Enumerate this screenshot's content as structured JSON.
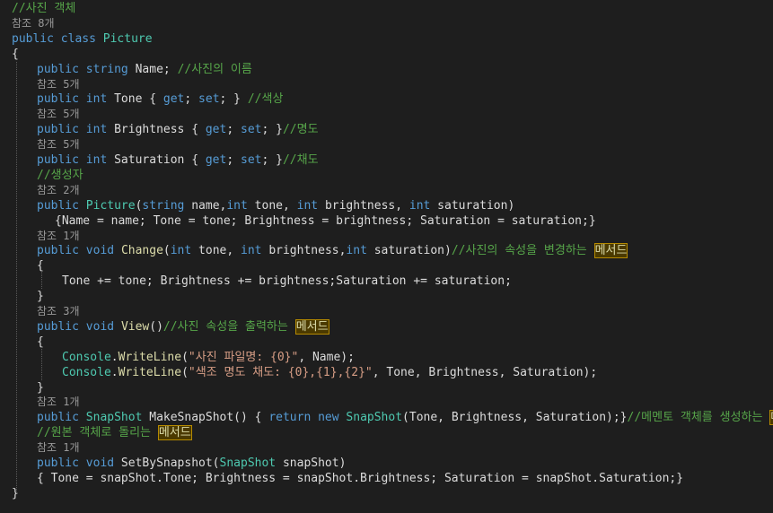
{
  "lines": [
    {
      "indent": 0,
      "kind": "comment",
      "segments": [
        {
          "t": "//사진 객체",
          "c": "cm"
        }
      ]
    },
    {
      "indent": 0,
      "kind": "lens",
      "segments": [
        {
          "t": "참조 8개",
          "c": "lens"
        }
      ]
    },
    {
      "indent": 0,
      "kind": "code",
      "segments": [
        {
          "t": "public",
          "c": "kw"
        },
        {
          "t": " "
        },
        {
          "t": "class",
          "c": "kw"
        },
        {
          "t": " "
        },
        {
          "t": "Picture",
          "c": "cl"
        }
      ]
    },
    {
      "indent": 0,
      "kind": "code",
      "segments": [
        {
          "t": "{"
        }
      ]
    },
    {
      "indent": 1,
      "kind": "code",
      "segments": [
        {
          "t": "public",
          "c": "kw"
        },
        {
          "t": " "
        },
        {
          "t": "string",
          "c": "kw"
        },
        {
          "t": " Name; "
        },
        {
          "t": "//사진의 이름",
          "c": "cm"
        }
      ]
    },
    {
      "indent": 1,
      "kind": "lens",
      "segments": [
        {
          "t": "참조 5개",
          "c": "lens"
        }
      ]
    },
    {
      "indent": 1,
      "kind": "code",
      "segments": [
        {
          "t": "public",
          "c": "kw"
        },
        {
          "t": " "
        },
        {
          "t": "int",
          "c": "kw"
        },
        {
          "t": " Tone { "
        },
        {
          "t": "get",
          "c": "kw"
        },
        {
          "t": "; "
        },
        {
          "t": "set",
          "c": "kw"
        },
        {
          "t": "; } "
        },
        {
          "t": "//색상",
          "c": "cm"
        }
      ]
    },
    {
      "indent": 1,
      "kind": "lens",
      "segments": [
        {
          "t": "참조 5개",
          "c": "lens"
        }
      ]
    },
    {
      "indent": 1,
      "kind": "code",
      "segments": [
        {
          "t": "public",
          "c": "kw"
        },
        {
          "t": " "
        },
        {
          "t": "int",
          "c": "kw"
        },
        {
          "t": " Brightness { "
        },
        {
          "t": "get",
          "c": "kw"
        },
        {
          "t": "; "
        },
        {
          "t": "set",
          "c": "kw"
        },
        {
          "t": "; }"
        },
        {
          "t": "//명도",
          "c": "cm"
        }
      ]
    },
    {
      "indent": 1,
      "kind": "lens",
      "segments": [
        {
          "t": "참조 5개",
          "c": "lens"
        }
      ]
    },
    {
      "indent": 1,
      "kind": "code",
      "segments": [
        {
          "t": "public",
          "c": "kw"
        },
        {
          "t": " "
        },
        {
          "t": "int",
          "c": "kw"
        },
        {
          "t": " Saturation { "
        },
        {
          "t": "get",
          "c": "kw"
        },
        {
          "t": "; "
        },
        {
          "t": "set",
          "c": "kw"
        },
        {
          "t": "; }"
        },
        {
          "t": "//채도",
          "c": "cm"
        }
      ]
    },
    {
      "indent": 1,
      "kind": "comment",
      "segments": [
        {
          "t": "//생성자",
          "c": "cm"
        }
      ]
    },
    {
      "indent": 1,
      "kind": "lens",
      "segments": [
        {
          "t": "참조 2개",
          "c": "lens"
        }
      ]
    },
    {
      "indent": 1,
      "kind": "code",
      "segments": [
        {
          "t": "public",
          "c": "kw"
        },
        {
          "t": " "
        },
        {
          "t": "Picture",
          "c": "cl"
        },
        {
          "t": "("
        },
        {
          "t": "string",
          "c": "kw"
        },
        {
          "t": " name,"
        },
        {
          "t": "int",
          "c": "kw"
        },
        {
          "t": " tone, "
        },
        {
          "t": "int",
          "c": "kw"
        },
        {
          "t": " brightness, "
        },
        {
          "t": "int",
          "c": "kw"
        },
        {
          "t": " saturation)"
        }
      ]
    },
    {
      "indent": 1,
      "kind": "code",
      "pad": "  ",
      "segments": [
        {
          "t": "{Name = name; Tone = tone; Brightness = brightness; Saturation = saturation;}"
        }
      ]
    },
    {
      "indent": 1,
      "kind": "lens",
      "segments": [
        {
          "t": "참조 1개",
          "c": "lens"
        }
      ]
    },
    {
      "indent": 1,
      "kind": "code",
      "segments": [
        {
          "t": "public",
          "c": "kw"
        },
        {
          "t": " "
        },
        {
          "t": "void",
          "c": "kw"
        },
        {
          "t": " "
        },
        {
          "t": "Change",
          "c": "me"
        },
        {
          "t": "("
        },
        {
          "t": "int",
          "c": "kw"
        },
        {
          "t": " tone, "
        },
        {
          "t": "int",
          "c": "kw"
        },
        {
          "t": " brightness,"
        },
        {
          "t": "int",
          "c": "kw"
        },
        {
          "t": " saturation)"
        },
        {
          "t": "//사진의 속성을 변경하는 ",
          "c": "cm"
        },
        {
          "t": "메서드",
          "c": "hl"
        }
      ]
    },
    {
      "indent": 1,
      "kind": "code",
      "segments": [
        {
          "t": "{"
        }
      ]
    },
    {
      "indent": 2,
      "kind": "code",
      "segments": [
        {
          "t": "Tone += tone; Brightness += brightness;Saturation += saturation;"
        }
      ]
    },
    {
      "indent": 1,
      "kind": "code",
      "segments": [
        {
          "t": "}"
        }
      ]
    },
    {
      "indent": 1,
      "kind": "lens",
      "segments": [
        {
          "t": "참조 3개",
          "c": "lens"
        }
      ]
    },
    {
      "indent": 1,
      "kind": "code",
      "segments": [
        {
          "t": "public",
          "c": "kw"
        },
        {
          "t": " "
        },
        {
          "t": "void",
          "c": "kw"
        },
        {
          "t": " "
        },
        {
          "t": "View",
          "c": "me"
        },
        {
          "t": "()"
        },
        {
          "t": "//사진 속성을 출력하는 ",
          "c": "cm"
        },
        {
          "t": "메서드",
          "c": "hl"
        }
      ]
    },
    {
      "indent": 1,
      "kind": "code",
      "segments": [
        {
          "t": "{"
        }
      ]
    },
    {
      "indent": 2,
      "kind": "code",
      "segments": [
        {
          "t": "Console",
          "c": "cl"
        },
        {
          "t": "."
        },
        {
          "t": "WriteLine",
          "c": "me"
        },
        {
          "t": "("
        },
        {
          "t": "\"사진 파일명: {0}\"",
          "c": "st"
        },
        {
          "t": ", Name);"
        }
      ]
    },
    {
      "indent": 2,
      "kind": "code",
      "segments": [
        {
          "t": "Console",
          "c": "cl"
        },
        {
          "t": "."
        },
        {
          "t": "WriteLine",
          "c": "me"
        },
        {
          "t": "("
        },
        {
          "t": "\"색조 명도 채도: {0},{1},{2}\"",
          "c": "st"
        },
        {
          "t": ", Tone, Brightness, Saturation);"
        }
      ]
    },
    {
      "indent": 1,
      "kind": "code",
      "segments": [
        {
          "t": "}"
        }
      ]
    },
    {
      "indent": 1,
      "kind": "lens",
      "segments": [
        {
          "t": "참조 1개",
          "c": "lens"
        }
      ]
    },
    {
      "indent": 1,
      "kind": "code",
      "segments": [
        {
          "t": "public",
          "c": "kw"
        },
        {
          "t": " "
        },
        {
          "t": "SnapShot",
          "c": "cl"
        },
        {
          "t": " MakeSnapShot() { "
        },
        {
          "t": "return",
          "c": "kw"
        },
        {
          "t": " "
        },
        {
          "t": "new",
          "c": "kw"
        },
        {
          "t": " "
        },
        {
          "t": "SnapShot",
          "c": "cl"
        },
        {
          "t": "(Tone, Brightness, Saturation);}"
        },
        {
          "t": "//메멘토 객체를 생성하는 ",
          "c": "cm"
        },
        {
          "t": "메서드",
          "c": "hl"
        }
      ]
    },
    {
      "indent": 1,
      "kind": "comment",
      "segments": [
        {
          "t": "//원본 객체로 돌리는 ",
          "c": "cm"
        },
        {
          "t": "메서드",
          "c": "hl"
        }
      ]
    },
    {
      "indent": 1,
      "kind": "lens",
      "segments": [
        {
          "t": "참조 1개",
          "c": "lens"
        }
      ]
    },
    {
      "indent": 1,
      "kind": "code",
      "segments": [
        {
          "t": "public",
          "c": "kw"
        },
        {
          "t": " "
        },
        {
          "t": "void",
          "c": "kw"
        },
        {
          "t": " SetBySnapshot("
        },
        {
          "t": "SnapShot",
          "c": "cl"
        },
        {
          "t": " snapShot)"
        }
      ]
    },
    {
      "indent": 1,
      "kind": "code",
      "segments": [
        {
          "t": "{ Tone = snapShot.Tone; Brightness = snapShot.Brightness; Saturation = snapShot.Saturation;}"
        }
      ]
    },
    {
      "indent": 0,
      "kind": "code",
      "segments": [
        {
          "t": "}"
        }
      ]
    }
  ]
}
